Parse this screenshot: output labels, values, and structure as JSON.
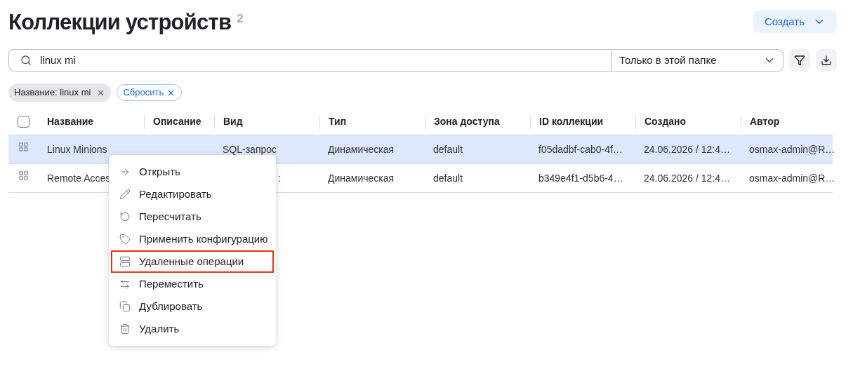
{
  "header": {
    "title": "Коллекции устройств",
    "count": "2",
    "create_button": "Создать"
  },
  "search": {
    "value": "linux mi",
    "scope": "Только в этой папке"
  },
  "filters": [
    {
      "kind": "tag",
      "label": "Название: linux mi"
    },
    {
      "kind": "reset",
      "label": "Сбросить"
    }
  ],
  "table": {
    "select_all": {
      "checked": false
    },
    "columns": [
      "Название",
      "Описание",
      "Вид",
      "Тип",
      "Зона доступа",
      "ID коллекции",
      "Создано",
      "Автор"
    ],
    "rows": [
      {
        "selected": true,
        "cells": [
          "Linux Minions",
          "",
          "SQL-запрос",
          "Динамическая",
          "default",
          "f05dadbf-cab0-4f…",
          "24.06.2026 / 12:4…",
          "osmax-admin@R…"
        ]
      },
      {
        "selected": false,
        "cells": [
          "Remote Acces",
          "",
          ":",
          "Динамическая",
          "default",
          "b349e4f1-d5b6-4…",
          "24.06.2026 / 12:4…",
          "osmax-admin@R…"
        ]
      }
    ]
  },
  "context_menu": [
    {
      "kind": "open",
      "label": "Открыть",
      "highlighted": false
    },
    {
      "kind": "edit",
      "label": "Редактировать",
      "highlighted": false
    },
    {
      "kind": "recalc",
      "label": "Пересчитать",
      "highlighted": false
    },
    {
      "kind": "config",
      "label": "Применить конфигурацию",
      "highlighted": false
    },
    {
      "kind": "remote",
      "label": "Удаленные операции",
      "highlighted": true
    },
    {
      "kind": "move",
      "label": "Переместить",
      "highlighted": false
    },
    {
      "kind": "duplicate",
      "label": "Дублировать",
      "highlighted": false
    },
    {
      "kind": "delete",
      "label": "Удалить",
      "highlighted": false
    }
  ]
}
